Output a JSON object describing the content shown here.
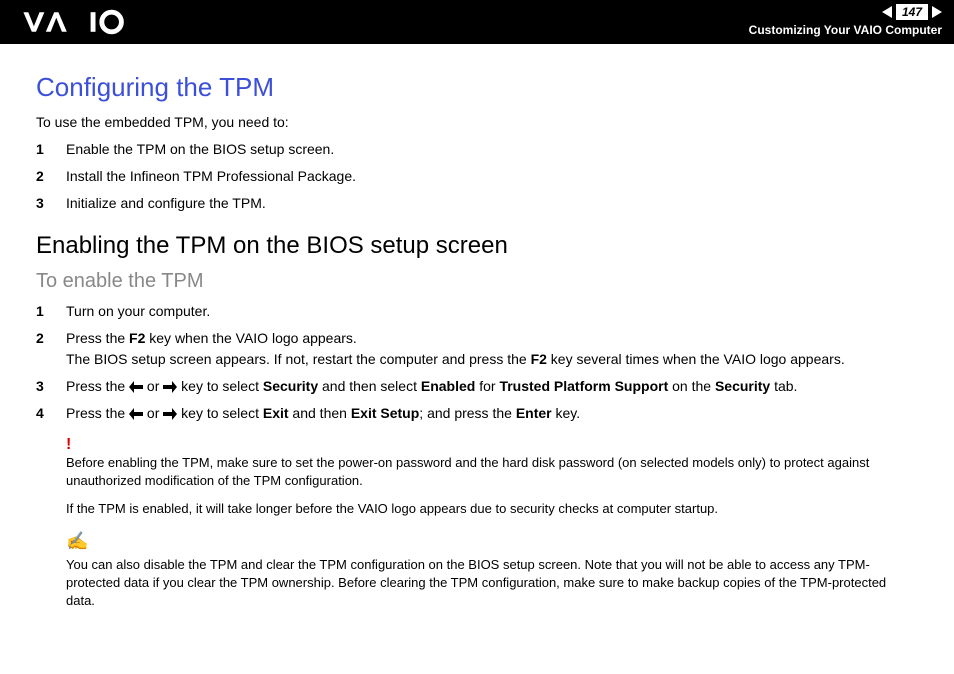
{
  "header": {
    "page_number": "147",
    "breadcrumb": "Customizing Your VAIO Computer"
  },
  "h1": "Configuring the TPM",
  "intro": "To use the embedded TPM, you need to:",
  "steps_a": [
    "Enable the TPM on the BIOS setup screen.",
    "Install the Infineon TPM Professional Package.",
    "Initialize and configure the TPM."
  ],
  "h2": "Enabling the TPM on the BIOS setup screen",
  "h3": "To enable the TPM",
  "steps_b": {
    "s1": "Turn on your computer.",
    "s2_a": "Press the ",
    "s2_b": "F2",
    "s2_c": " key when the VAIO logo appears.",
    "s2_d": "The BIOS setup screen appears. If not, restart the computer and press the ",
    "s2_e": "F2",
    "s2_f": " key several times when the VAIO logo appears.",
    "s3_a": "Press the ",
    "s3_or": " or ",
    "s3_b": " key to select ",
    "s3_sec": "Security",
    "s3_c": " and then select ",
    "s3_en": "Enabled",
    "s3_d": " for ",
    "s3_tps": "Trusted Platform Support",
    "s3_e": " on the ",
    "s3_sec2": "Security",
    "s3_f": " tab.",
    "s4_a": "Press the ",
    "s4_or": " or ",
    "s4_b": " key to select ",
    "s4_exit": "Exit",
    "s4_c": " and then ",
    "s4_es": "Exit Setup",
    "s4_d": "; and press the ",
    "s4_enter": "Enter",
    "s4_e": " key."
  },
  "warn1": "Before enabling the TPM, make sure to set the power-on password and the hard disk password (on selected models only) to protect against unauthorized modification of the TPM configuration.",
  "warn2": "If the TPM is enabled, it will take longer before the VAIO logo appears due to security checks at computer startup.",
  "note": "You can also disable the TPM and clear the TPM configuration on the BIOS setup screen. Note that you will not be able to access any TPM-protected data if you clear the TPM ownership. Before clearing the TPM configuration, make sure to make backup copies of the TPM-protected data."
}
